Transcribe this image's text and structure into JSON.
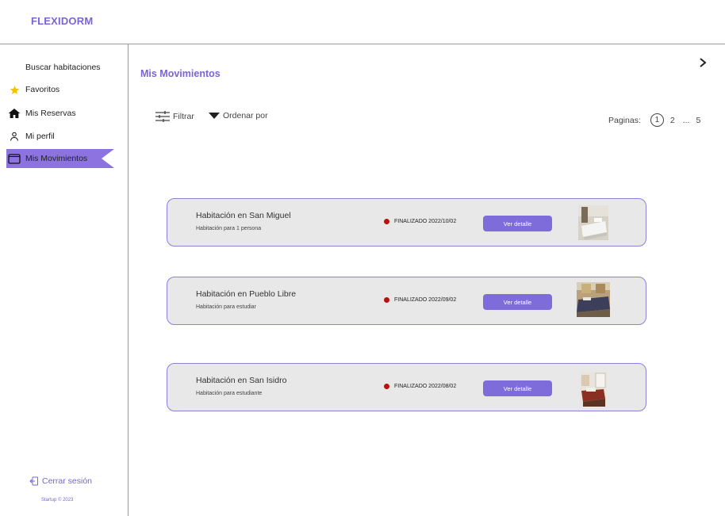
{
  "brand": {
    "name": "FLEXIDORM",
    "accent": "#7b63d8"
  },
  "sidebar": {
    "items": [
      {
        "label": "Buscar habitaciones",
        "icon": "none"
      },
      {
        "label": "Favoritos",
        "icon": "star-icon"
      },
      {
        "label": "Mis Reservas",
        "icon": "home-icon"
      },
      {
        "label": "Mi perfil",
        "icon": "person-icon"
      },
      {
        "label": "Mis Movimientos",
        "icon": "window-icon",
        "active": true
      }
    ],
    "logout_label": "Cerrar sesión",
    "footer": "Startup © 2023"
  },
  "main": {
    "title": "Mis Movimientos",
    "filter_label": "Filtrar",
    "sort_label": "Ordenar por",
    "pagination": {
      "label": "Paginas:",
      "current": "1",
      "next": "2",
      "ellipsis": "...",
      "last": "5"
    }
  },
  "cards": [
    {
      "title": "Habitación en San Miguel",
      "subtitle": "Habitación para 1 persona",
      "status": "FINALIZADO 2022/10/02",
      "button": "Ver detalle"
    },
    {
      "title": "Habitación en Pueblo Libre",
      "subtitle": "Habitación para estudiar",
      "status": "FINALIZADO 2022/09/02",
      "button": "Ver detalle"
    },
    {
      "title": "Habitación en San Isidro",
      "subtitle": "Habitación para estudiante",
      "status": "FINALIZADO 2022/08/02",
      "button": "Ver detalle"
    }
  ],
  "colors": {
    "accent": "#7b63d8",
    "button": "#7e6cdb",
    "status_dot": "#b51212",
    "card_bg": "#e8e8e8",
    "star": "#f2c500"
  }
}
